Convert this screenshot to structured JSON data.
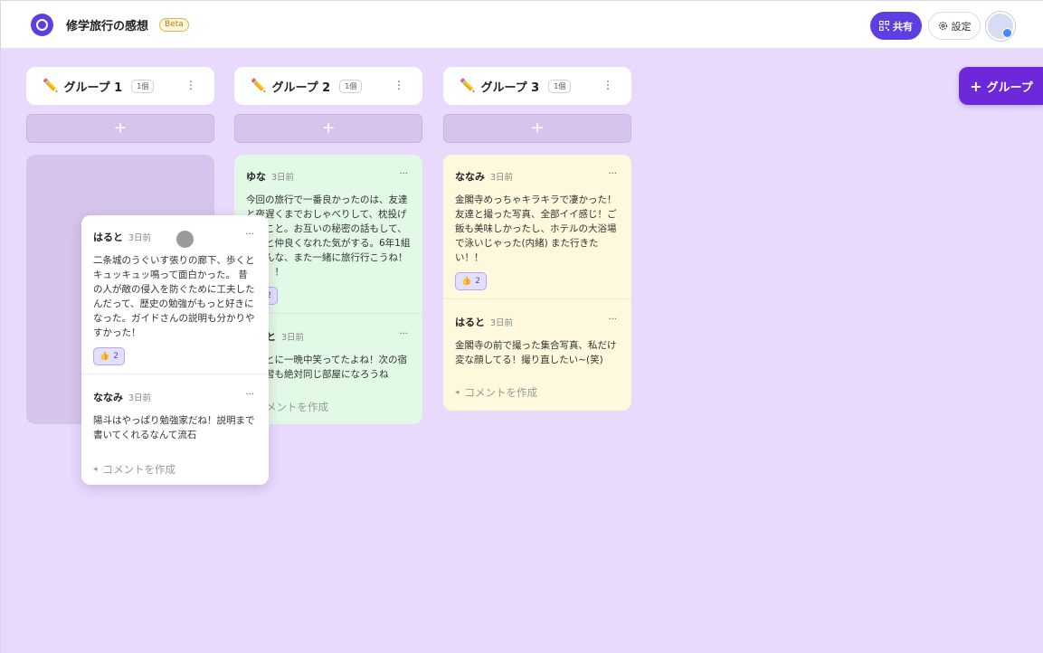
{
  "header": {
    "app_title": "修学旅行の感想",
    "beta": "Beta",
    "share_label": "共有",
    "settings_label": "設定"
  },
  "add_group_label": "グループ",
  "columns": [
    {
      "name": "グループ 1",
      "count": "1個",
      "posts": []
    },
    {
      "name": "グループ 2",
      "count": "1個",
      "posts": [
        {
          "author": "ゆな",
          "time": "3日前",
          "text": "今回の旅行で一番良かったのは、友達と夜遅くまでおしゃべりして、枕投げしたこと。お互いの秘密の話もして、もっと仲良くなれた気がする。6年1組のみんな、また一緒に旅行行こうね！最高！！",
          "likes": "2"
        },
        {
          "author": "はると",
          "time": "3日前",
          "text": "ほんとに一晩中笑ってたよね！次の宿泊学習も絶対同じ部屋になろうね"
        }
      ],
      "comment_placeholder": "コメントを作成"
    },
    {
      "name": "グループ 3",
      "count": "1個",
      "posts": [
        {
          "author": "ななみ",
          "time": "3日前",
          "text": "金閣寺めっちゃキラキラで凄かった！友達と撮った写真、全部イイ感じ！ご飯も美味しかったし、ホテルの大浴場で泳いじゃった(内緒) また行きたい！！",
          "likes": "2"
        },
        {
          "author": "はると",
          "time": "3日前",
          "text": "金閣寺の前で撮った集合写真、私だけ変な顔してる！撮り直したい~(笑)"
        }
      ],
      "comment_placeholder": "コメントを作成"
    }
  ],
  "dragged_card": {
    "author": "はると",
    "time": "3日前",
    "text": "二条城のうぐいす張りの廊下、歩くとキュッキュッ鳴って面白かった。 昔の人が敵の侵入を防ぐために工夫したんだって、歴史の勉強がもっと好きになった。ガイドさんの説明も分かりやすかった！",
    "likes": "2",
    "reply_author": "ななみ",
    "reply_time": "3日前",
    "reply_text": "陽斗はやっぱり勉強家だね！説明まで書いてくれるなんて流石",
    "comment_placeholder": "コメントを作成"
  },
  "icons": {
    "pencil": "✏️",
    "more": "⋮",
    "dots": "···",
    "plus": "+",
    "send": "◂",
    "like": "👍"
  },
  "colors": {
    "board_bg": "#e8d9fd",
    "accent": "#5b3fe0",
    "add_group": "#6d28d9",
    "green_card": "#e2f9e6",
    "yellow_card": "#fef8dc",
    "empty_column": "#d6c4ec"
  }
}
